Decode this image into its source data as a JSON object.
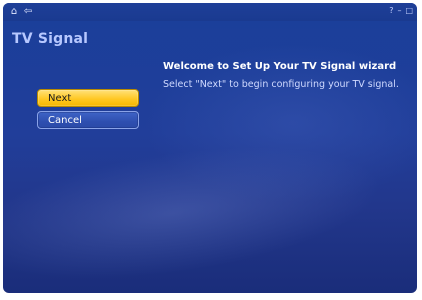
{
  "window": {
    "title": "TV Signal"
  },
  "nav": {
    "home_icon": "home-icon",
    "back_icon": "back-arrow-icon"
  },
  "window_controls": {
    "help_icon": "help-icon",
    "minimize_icon": "minimize-icon",
    "restore_icon": "restore-icon"
  },
  "buttons": {
    "next_label": "Next",
    "cancel_label": "Cancel"
  },
  "main": {
    "heading": "Welcome to Set Up Your TV Signal wizard",
    "body": "Select \"Next\" to begin configuring your TV signal."
  },
  "colors": {
    "background": "#213e9a",
    "accent": "#ffc825",
    "title_text": "#b7c8ff"
  }
}
